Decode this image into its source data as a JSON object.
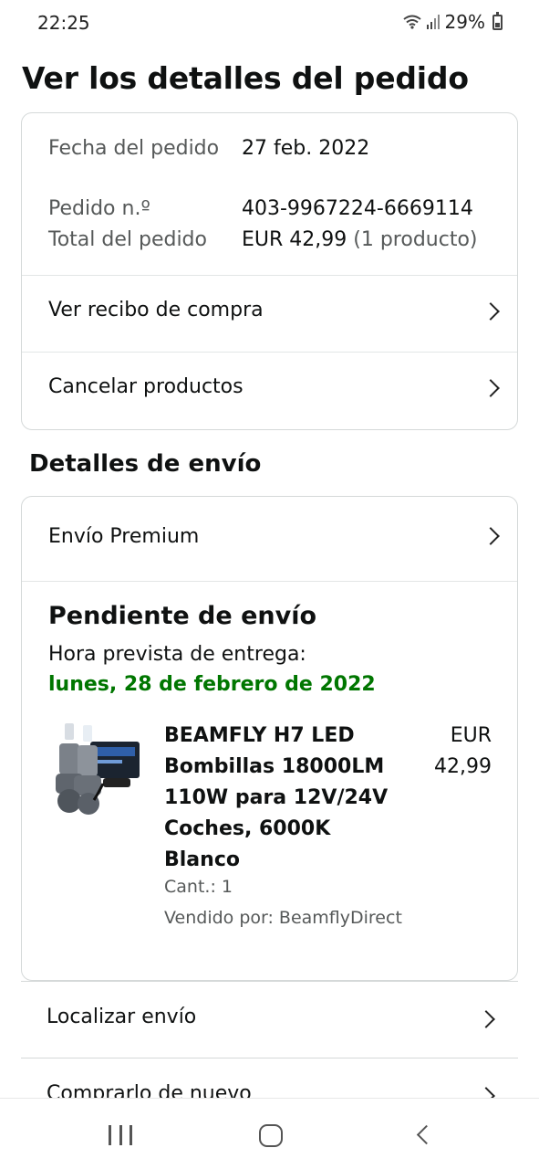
{
  "status_bar": {
    "time": "22:25",
    "battery": "29%"
  },
  "page_title": "Ver los detalles del pedido",
  "order_info": {
    "date_label": "Fecha del pedido",
    "date_value": "27 feb. 2022",
    "number_label": "Pedido n.º",
    "number_value": "403-9967224-6669114",
    "total_label": "Total del pedido",
    "total_value": "EUR 42,99",
    "total_count": "(1 producto)"
  },
  "actions": {
    "receipt": "Ver recibo de compra",
    "cancel": "Cancelar productos"
  },
  "shipping": {
    "section_title": "Detalles de envío",
    "method": "Envío Premium",
    "status": "Pendiente de envío",
    "eta_label": "Hora prevista de entrega:",
    "eta_date": "lunes, 28 de febrero de 2022",
    "eta_color": "#007600"
  },
  "product": {
    "name": "BEAMFLY H7 LED Bombillas 18000LM 110W para 12V/24V Coches, 6000K Blanco",
    "price_currency": "EUR",
    "price_amount": "42,99",
    "quantity": "Cant.: 1",
    "seller": "Vendido por: BeamflyDirect"
  },
  "bottom_actions": {
    "track": "Localizar envío",
    "buy_again": "Comprarlo de nuevo"
  },
  "icons": {
    "chevron": "chevron-right-icon",
    "wifi": "wifi-icon",
    "signal": "signal-icon",
    "battery": "battery-icon"
  }
}
